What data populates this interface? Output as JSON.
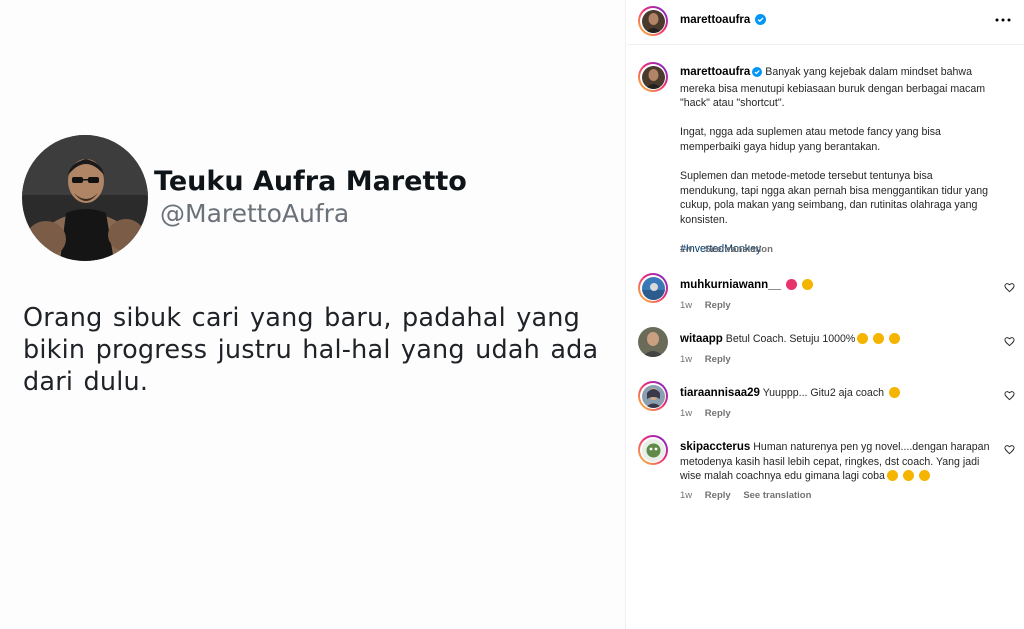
{
  "media": {
    "name": "Teuku Aufra Maretto",
    "handle": "@MarettoAufra",
    "text": "Orang sibuk cari yang baru, padahal yang bikin progress justru hal-hal yang udah ada dari dulu."
  },
  "post": {
    "author": "marettoaufra",
    "more_icon": "more-horizontal-icon"
  },
  "caption": {
    "author": "marettoaufra",
    "paragraphs": [
      "Banyak yang kejebak dalam mindset bahwa mereka bisa menutupi kebiasaan buruk dengan berbagai macam \"hack\" atau \"shortcut\".",
      "Ingat, ngga ada suplemen atau metode fancy yang bisa memperbaiki gaya hidup yang berantakan.",
      "Suplemen dan metode-metode tersebut tentunya bisa mendukung, tapi ngga akan pernah bisa menggantikan tidur yang cukup, pola makan yang seimbang, dan rutinitas olahraga yang konsisten."
    ],
    "hashtag": "#InvertedMonkey",
    "time": "1w",
    "see_translation": "See translation"
  },
  "comments": [
    {
      "user": "muhkurniawann__",
      "text": "",
      "emojis": [
        "💯",
        "👏"
      ],
      "time": "1w",
      "reply": "Reply"
    },
    {
      "user": "witaapp",
      "text": "Betul Coach. Setuju 1000%",
      "emojis": [
        "🙌",
        "👌",
        "👌"
      ],
      "time": "1w",
      "reply": "Reply"
    },
    {
      "user": "tiaraannisaa29",
      "text": "Yuuppp... Gitu2 aja coach",
      "emojis": [
        "😆"
      ],
      "time": "1w",
      "reply": "Reply"
    },
    {
      "user": "skipaccterus",
      "text": "Human naturenya pen yg novel....dengan harapan metodenya kasih hasil lebih cepat, ringkes, dst coach. Yang jadi wise malah coachnya edu gimana lagi coba",
      "emojis": [
        "😂",
        "😂",
        "😂"
      ],
      "time": "1w",
      "reply": "Reply",
      "see_translation": "See translation"
    }
  ],
  "colors": {
    "verified": "#0095f6",
    "hashtag": "#00376b",
    "meta": "#737373"
  }
}
